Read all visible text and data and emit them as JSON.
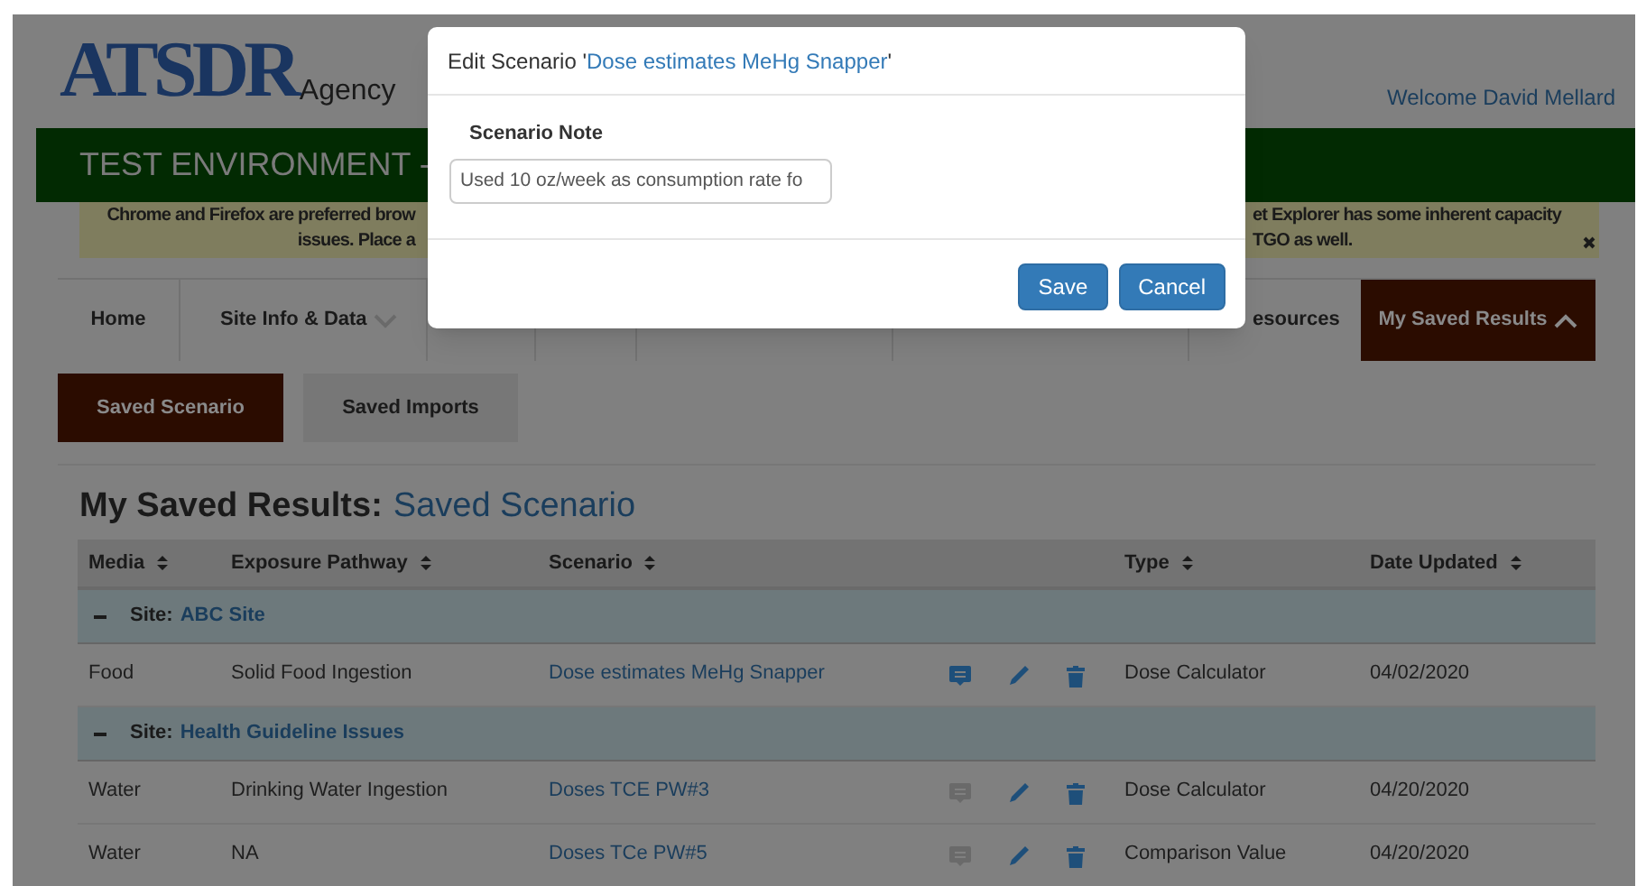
{
  "header": {
    "logo_text": "ATSDR",
    "logo_subtext": "Agency",
    "welcome": "Welcome David Mellard"
  },
  "environment_banner": "TEST ENVIRONMENT -",
  "browser_notice": {
    "left_lines": [
      "Chrome and Firefox are preferred brow",
      "issues. Place a"
    ],
    "right_lines": [
      "et Explorer has some inherent capacity",
      "TGO as well."
    ]
  },
  "nav": [
    {
      "label": "Home",
      "selected": false,
      "has_menu": false
    },
    {
      "label": "Site Info & Data",
      "selected": false,
      "has_menu": true,
      "expanded": false
    },
    {
      "label": "esources",
      "selected": false,
      "has_menu": false
    },
    {
      "label": "My Saved Results",
      "selected": true,
      "has_menu": true,
      "expanded": true
    }
  ],
  "subtabs": [
    {
      "label": "Saved Scenario",
      "selected": true
    },
    {
      "label": "Saved Imports",
      "selected": false
    }
  ],
  "heading": {
    "prefix": "My Saved Results:",
    "section": "Saved Scenario"
  },
  "table": {
    "columns": [
      "Media",
      "Exposure Pathway",
      "Scenario",
      "Type",
      "Date Updated"
    ],
    "rows": [
      {
        "kind": "group",
        "label": "Site:",
        "site": "ABC Site",
        "expanded": true
      },
      {
        "kind": "item",
        "media": "Food",
        "pathway": "Solid Food Ingestion",
        "scenario": "Dose estimates MeHg Snapper",
        "has_note": true,
        "type": "Dose Calculator",
        "date": "04/02/2020"
      },
      {
        "kind": "group",
        "label": "Site:",
        "site": "Health Guideline Issues",
        "expanded": true
      },
      {
        "kind": "item",
        "media": "Water",
        "pathway": "Drinking Water Ingestion",
        "scenario": "Doses TCE PW#3",
        "has_note": false,
        "type": "Dose Calculator",
        "date": "04/20/2020"
      },
      {
        "kind": "item",
        "media": "Water",
        "pathway": "NA",
        "scenario": "Doses TCe PW#5",
        "has_note": false,
        "type": "Comparison Value",
        "date": "04/20/2020"
      }
    ]
  },
  "modal": {
    "title_prefix": "Edit Scenario '",
    "title_link": "Dose estimates MeHg Snapper",
    "title_suffix": "'",
    "field_label": "Scenario Note",
    "field_value": "Used 10 oz/week as consumption rate fo",
    "buttons": [
      "Save",
      "Cancel"
    ]
  }
}
